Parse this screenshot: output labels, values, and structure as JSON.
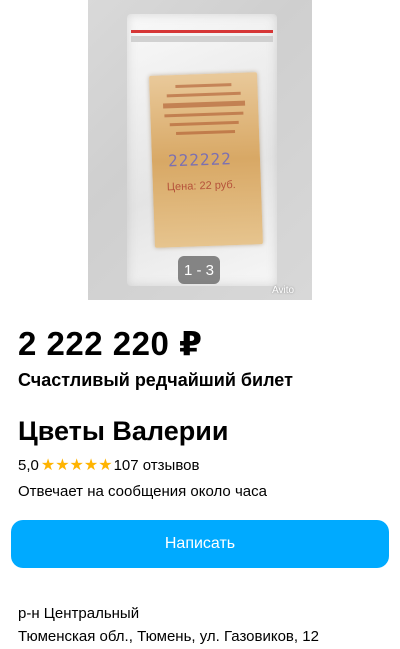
{
  "gallery": {
    "counter": "1 - 3",
    "watermark": "Avito",
    "photo": {
      "ticket_number": "222222",
      "ticket_price": "Цена: 22 руб."
    }
  },
  "listing": {
    "price": "2 222 220 ₽",
    "title": "Счастливый редчайший билет"
  },
  "seller": {
    "name": "Цветы Валерии",
    "rating": "5,0",
    "stars": 5,
    "reviews": "107 отзывов",
    "response_time": "Отвечает на сообщения около часа"
  },
  "actions": {
    "write_label": "Написать"
  },
  "location": {
    "district": "р-н Центральный",
    "address": "Тюменская обл., Тюмень, ул. Газовиков, 12"
  },
  "colors": {
    "accent": "#00aaff",
    "star": "#ffb400"
  }
}
